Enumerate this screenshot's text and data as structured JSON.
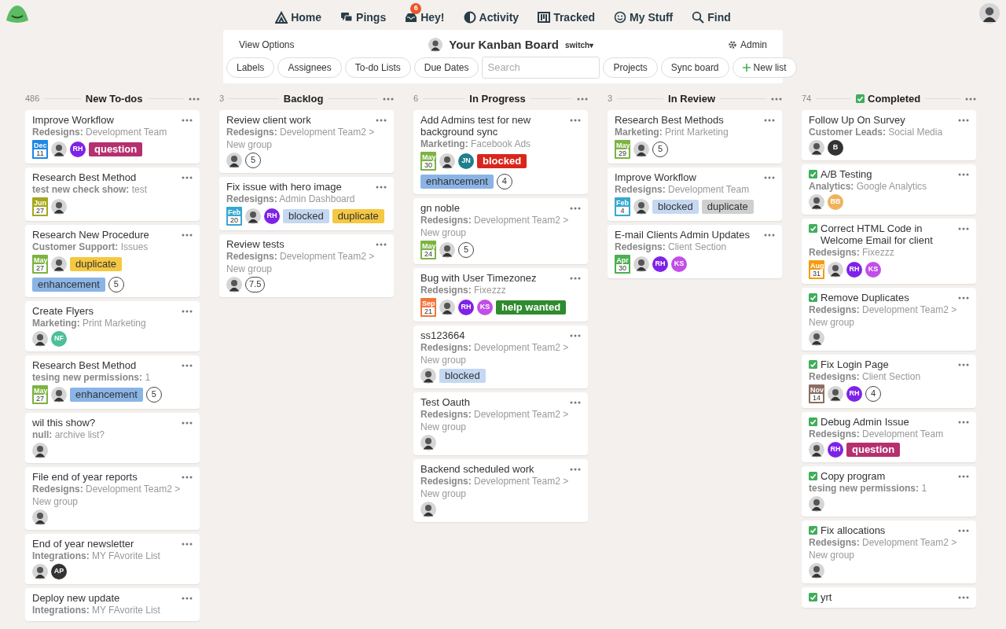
{
  "nav": [
    {
      "label": "Home"
    },
    {
      "label": "Pings"
    },
    {
      "label": "Hey!",
      "badge": "6"
    },
    {
      "label": "Activity"
    },
    {
      "label": "Tracked"
    },
    {
      "label": "My Stuff"
    },
    {
      "label": "Find"
    }
  ],
  "toolbar": {
    "view_options": "View Options",
    "board_title": "Your Kanban Board",
    "switch": "switch▾",
    "admin": "Admin",
    "buttons": [
      {
        "label": "Labels"
      },
      {
        "label": "Assignees"
      },
      {
        "label": "To-do Lists"
      },
      {
        "label": "Due Dates"
      },
      {
        "kind": "search",
        "placeholder": "Search"
      },
      {
        "label": "Projects"
      },
      {
        "label": "Sync board"
      },
      {
        "label": "New list",
        "kind": "add"
      }
    ]
  },
  "columns": [
    {
      "count": "486",
      "title": "New To-dos",
      "completed": false,
      "cards": [
        {
          "title": "Improve Workflow",
          "project": "Redesigns:",
          "list": "Development Team",
          "due": {
            "month": "Dec",
            "day": "11",
            "color": "#1e88e5"
          },
          "people": [
            {
              "kind": "photo"
            },
            {
              "kind": "initials",
              "initials": "RH",
              "color": "#7e22e8"
            }
          ],
          "labels": [
            {
              "text": "question",
              "color": "#b5306e"
            }
          ]
        },
        {
          "title": "Research Best Method",
          "project": "test new check show:",
          "list": "test",
          "due": {
            "month": "Jun",
            "day": "27",
            "color": "#a5a81a"
          },
          "people": [
            {
              "kind": "photo"
            }
          ]
        },
        {
          "title": "Research New Procedure",
          "project": "Customer Support:",
          "list": "Issues",
          "due": {
            "month": "May",
            "day": "27",
            "color": "#7cb342"
          },
          "people": [
            {
              "kind": "photo"
            }
          ],
          "labels": [
            {
              "text": "duplicate",
              "color": "#f5c842"
            },
            {
              "text": "enhancement",
              "color": "#8ab4e6"
            }
          ],
          "points": "5"
        },
        {
          "title": "Create Flyers",
          "project": "Marketing:",
          "list": "Print Marketing",
          "people": [
            {
              "kind": "photo"
            },
            {
              "kind": "initials",
              "initials": "NF",
              "color": "#4cc09a"
            }
          ]
        },
        {
          "title": "Research Best Method",
          "project": "tesing new permissions:",
          "list": "1",
          "due": {
            "month": "May",
            "day": "27",
            "color": "#7cb342"
          },
          "people": [
            {
              "kind": "photo"
            }
          ],
          "labels": [
            {
              "text": "enhancement",
              "color": "#8ab4e6"
            }
          ],
          "points": "5"
        },
        {
          "title": "wil this show?",
          "project": "null:",
          "list": "archive list?",
          "people": [
            {
              "kind": "photo"
            }
          ]
        },
        {
          "title": "File end of year reports",
          "project": "Redesigns:",
          "list": "Development Team2 > New group",
          "people": [
            {
              "kind": "photo"
            }
          ]
        },
        {
          "title": "End of year newsletter",
          "project": "Integrations:",
          "list": "MY FAvorite List",
          "people": [
            {
              "kind": "photo"
            },
            {
              "kind": "initials",
              "initials": "AP",
              "color": "#333333"
            }
          ]
        },
        {
          "title": "Deploy new update",
          "project": "Integrations:",
          "list": "MY FAvorite List"
        }
      ]
    },
    {
      "count": "3",
      "title": "Backlog",
      "completed": false,
      "cards": [
        {
          "title": "Review client work",
          "project": "Redesigns:",
          "list": "Development Team2 > New group",
          "people": [
            {
              "kind": "photo"
            }
          ],
          "points": "5"
        },
        {
          "title": "Fix issue with hero image",
          "project": "Redesigns:",
          "list": "Admin Dashboard",
          "due": {
            "month": "Feb",
            "day": "20",
            "color": "#36a8d0"
          },
          "people": [
            {
              "kind": "photo"
            },
            {
              "kind": "initials",
              "initials": "RH",
              "color": "#7e22e8"
            }
          ],
          "labels": [
            {
              "text": "blocked",
              "color": "#c5d8f2"
            },
            {
              "text": "duplicate",
              "color": "#f5c842"
            }
          ]
        },
        {
          "title": "Review tests",
          "project": "Redesigns:",
          "list": "Development Team2 > New group",
          "people": [
            {
              "kind": "photo"
            }
          ],
          "points": "7.5"
        }
      ]
    },
    {
      "count": "6",
      "title": "In Progress",
      "completed": false,
      "cards": [
        {
          "title": "Add Admins test for new background sync",
          "project": "Marketing:",
          "list": "Facebook Ads",
          "due": {
            "month": "May",
            "day": "30",
            "color": "#7cb342"
          },
          "people": [
            {
              "kind": "photo"
            },
            {
              "kind": "initials",
              "initials": "JN",
              "color": "#1f7f8c"
            }
          ],
          "labels": [
            {
              "text": "blocked",
              "color": "#d9261c"
            },
            {
              "text": "enhancement",
              "color": "#8ab4e6"
            }
          ],
          "points": "4"
        },
        {
          "title": "gn noble",
          "project": "Redesigns:",
          "list": "Development Team2 > New group",
          "due": {
            "month": "May",
            "day": "24",
            "color": "#7cb342"
          },
          "people": [
            {
              "kind": "photo"
            }
          ],
          "points": "5"
        },
        {
          "title": "Bug with User Timezonez",
          "project": "Redesigns:",
          "list": "Fixezzz",
          "due": {
            "month": "Sep",
            "day": "21",
            "color": "#f4743b"
          },
          "people": [
            {
              "kind": "photo"
            },
            {
              "kind": "initials",
              "initials": "RH",
              "color": "#7e22e8"
            },
            {
              "kind": "initials",
              "initials": "KS",
              "color": "#c24ee8"
            }
          ],
          "labels": [
            {
              "text": "help wanted",
              "color": "#2e8b2e"
            }
          ]
        },
        {
          "title": "ss123664",
          "project": "Redesigns:",
          "list": "Development Team2 > New group",
          "people": [
            {
              "kind": "photo"
            }
          ],
          "labels": [
            {
              "text": "blocked",
              "color": "#c5d8f2"
            }
          ]
        },
        {
          "title": "Test Oauth",
          "project": "Redesigns:",
          "list": "Development Team2 > New group",
          "people": [
            {
              "kind": "photo"
            }
          ]
        },
        {
          "title": "Backend scheduled work",
          "project": "Redesigns:",
          "list": "Development Team2 > New group",
          "people": [
            {
              "kind": "photo"
            }
          ]
        }
      ]
    },
    {
      "count": "3",
      "title": "In Review",
      "completed": false,
      "cards": [
        {
          "title": "Research Best Methods",
          "project": "Marketing:",
          "list": "Print Marketing",
          "due": {
            "month": "May",
            "day": "29",
            "color": "#7cb342"
          },
          "people": [
            {
              "kind": "photo"
            }
          ],
          "points": "5"
        },
        {
          "title": "Improve Workflow",
          "project": "Redesigns:",
          "list": "Development Team",
          "due": {
            "month": "Feb",
            "day": "4",
            "color": "#36a8d0"
          },
          "people": [
            {
              "kind": "photo"
            }
          ],
          "labels": [
            {
              "text": "blocked",
              "color": "#c5d8f2"
            },
            {
              "text": "duplicate",
              "color": "#cfcfcf"
            }
          ]
        },
        {
          "title": "E-mail Clients Admin Updates",
          "project": "Redesigns:",
          "list": "Client Section",
          "due": {
            "month": "Apr",
            "day": "30",
            "color": "#4caf50"
          },
          "people": [
            {
              "kind": "photo"
            },
            {
              "kind": "initials",
              "initials": "RH",
              "color": "#7e22e8"
            },
            {
              "kind": "initials",
              "initials": "KS",
              "color": "#c24ee8"
            }
          ]
        }
      ]
    },
    {
      "count": "74",
      "title": "Completed",
      "completed": true,
      "cards": [
        {
          "title": "Follow Up On Survey",
          "completed": false,
          "project": "Customer Leads:",
          "list": "Social Media",
          "people": [
            {
              "kind": "photo"
            },
            {
              "kind": "initials",
              "initials": "B",
              "color": "#333333"
            }
          ]
        },
        {
          "title": "A/B Testing",
          "completed": true,
          "project": "Analytics:",
          "list": "Google Analytics",
          "people": [
            {
              "kind": "photo"
            },
            {
              "kind": "initials",
              "initials": "BB",
              "color": "#f0b35a"
            }
          ]
        },
        {
          "title": "Correct HTML Code in Welcome Email for client",
          "completed": true,
          "project": "Redesigns:",
          "list": "Fixezzz",
          "due": {
            "month": "Aug",
            "day": "31",
            "color": "#f39c12"
          },
          "people": [
            {
              "kind": "photo"
            },
            {
              "kind": "initials",
              "initials": "RH",
              "color": "#7e22e8"
            },
            {
              "kind": "initials",
              "initials": "KS",
              "color": "#c24ee8"
            }
          ]
        },
        {
          "title": "Remove Duplicates",
          "completed": true,
          "project": "Redesigns:",
          "list": "Development Team2 > New group",
          "people": [
            {
              "kind": "photo"
            }
          ]
        },
        {
          "title": "Fix Login Page",
          "completed": true,
          "project": "Redesigns:",
          "list": "Client Section",
          "due": {
            "month": "Nov",
            "day": "14",
            "color": "#8d6e63"
          },
          "people": [
            {
              "kind": "photo"
            },
            {
              "kind": "initials",
              "initials": "RH",
              "color": "#7e22e8"
            }
          ],
          "points": "4"
        },
        {
          "title": "Debug Admin Issue",
          "completed": true,
          "project": "Redesigns:",
          "list": "Development Team",
          "people": [
            {
              "kind": "photo"
            },
            {
              "kind": "initials",
              "initials": "RH",
              "color": "#7e22e8"
            }
          ],
          "labels": [
            {
              "text": "question",
              "color": "#b5306e"
            }
          ]
        },
        {
          "title": "Copy program",
          "completed": true,
          "project": "tesing new permissions:",
          "list": "1",
          "people": [
            {
              "kind": "photo"
            }
          ]
        },
        {
          "title": "Fix allocations",
          "completed": true,
          "project": "Redesigns:",
          "list": "Development Team2 > New group",
          "people": [
            {
              "kind": "photo"
            }
          ]
        },
        {
          "title": "yrt",
          "completed": true
        }
      ]
    }
  ]
}
